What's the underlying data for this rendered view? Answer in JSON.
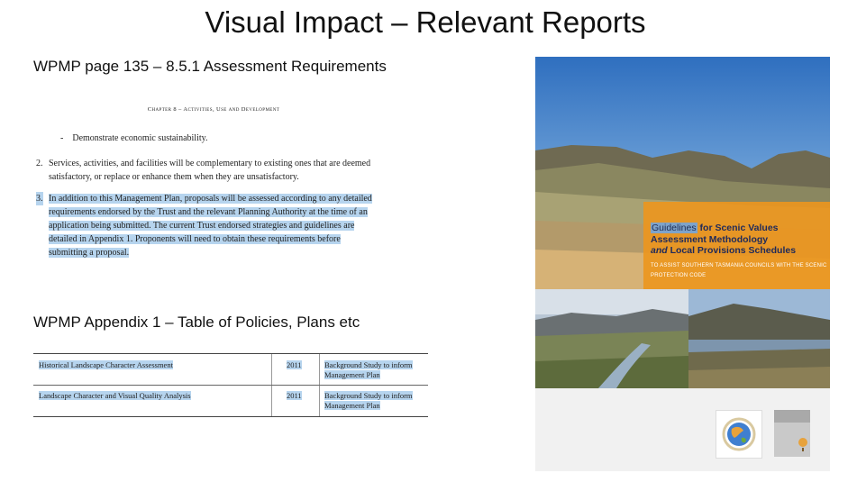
{
  "slide": {
    "title": "Visual Impact – Relevant Reports"
  },
  "section1": {
    "heading": "WPMP page 135 – 8.5.1 Assessment Requirements",
    "excerpt": {
      "chapter": "Chapter 8 – Activities, Use and Development",
      "bullet_dash": "-",
      "bullet_text": "Demonstrate economic sustainability.",
      "item2_num": "2.",
      "item2_text": "Services, activities, and facilities will be complementary to existing ones that are deemed satisfactory, or replace or enhance them when they are unsatisfactory.",
      "item3_num": "3.",
      "item3_text": "In addition to this Management Plan, proposals will be assessed according to any detailed requirements endorsed by the Trust and the relevant Planning Authority at the time of an application being submitted. The current Trust endorsed strategies and guidelines are detailed in Appendix 1. Proponents will need to obtain these requirements before submitting a proposal."
    }
  },
  "section2": {
    "heading": "WPMP Appendix 1 – Table of Policies, Plans etc",
    "rows": [
      {
        "name": "Historical Landscape Character Assessment",
        "year": "2011",
        "purpose": "Background Study to inform Management Plan"
      },
      {
        "name": "Landscape Character and Visual Quality Analysis",
        "year": "2011",
        "purpose": "Background Study to inform Management Plan"
      }
    ]
  },
  "cover": {
    "title_word1": "Guidelines",
    "title_rest1": " for Scenic Values",
    "title_line2": "Assessment Methodology",
    "title_and": "and",
    "title_rest3": " Local Provisions Schedules",
    "subtitle": "TO ASSIST SOUTHERN TASMANIA COUNCILS WITH THE SCENIC PROTECTION CODE"
  }
}
